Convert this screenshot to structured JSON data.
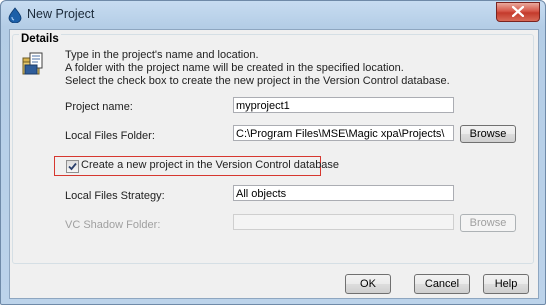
{
  "window": {
    "title": "New Project"
  },
  "details": {
    "group_title": "Details",
    "intro_lines": [
      "Type in the project's name and location.",
      "A folder with the project name will be created in the specified location.",
      "Select the check box to create the new project in the Version Control database."
    ]
  },
  "form": {
    "project_name_label": "Project name:",
    "project_name_value": "myproject1",
    "local_folder_label": "Local Files Folder:",
    "local_folder_value": "C:\\Program Files\\MSE\\Magic xpa\\Projects\\",
    "browse_label_1": "Browse",
    "vc_checkbox_label": "Create a new project in the Version Control database",
    "vc_checkbox_checked": true,
    "strategy_label": "Local Files Strategy:",
    "strategy_value": "All objects",
    "vc_shadow_label": "VC Shadow Folder:",
    "vc_shadow_value": "",
    "browse_label_2": "Browse"
  },
  "footer": {
    "ok_label": "OK",
    "cancel_label": "Cancel",
    "help_label": "Help"
  },
  "icons": {
    "app": "magic-drop-icon",
    "close": "close-icon",
    "info": "project-folder-icon",
    "check": "checkmark-icon"
  },
  "colors": {
    "highlight_border": "#d6372f",
    "titlebar": "#c7dcf1",
    "close_button": "#c43a2c"
  }
}
